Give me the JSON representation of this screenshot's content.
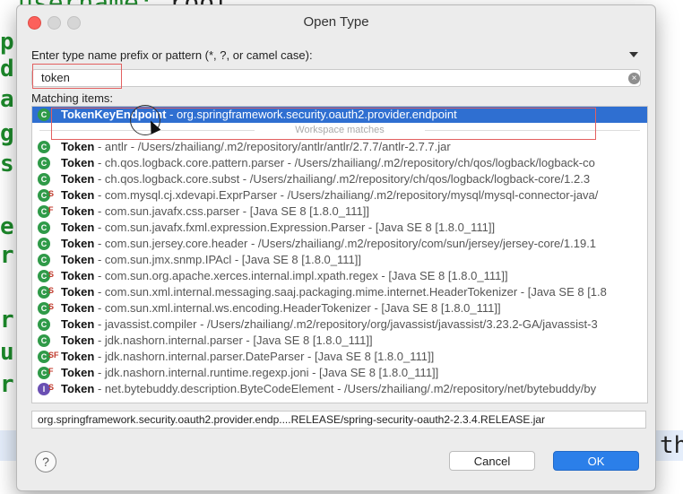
{
  "background_editor": {
    "top_line_key": "username:",
    "top_line_value": " root",
    "gutter_letters": [
      "p",
      "d",
      "a",
      "g",
      "s",
      "e",
      "r",
      "r",
      "u",
      "r"
    ],
    "right_text": "th"
  },
  "dialog": {
    "title": "Open Type",
    "prompt": "Enter type name prefix or pattern (*, ?, or camel case):",
    "search_value": "token",
    "matching_label": "Matching items:",
    "separator_label": "Workspace matches",
    "selected_row": {
      "name": "TokenKeyEndpoint",
      "detail": " - org.springframework.security.oauth2.provider.endpoint",
      "icon": "class-icon"
    },
    "rows": [
      {
        "name": "Token",
        "detail": " - antlr - /Users/zhailiang/.m2/repository/antlr/antlr/2.7.7/antlr-2.7.7.jar",
        "icon": "class-icon",
        "mod": ""
      },
      {
        "name": "Token",
        "detail": " - ch.qos.logback.core.pattern.parser - /Users/zhailiang/.m2/repository/ch/qos/logback/logback-co",
        "icon": "class-icon",
        "mod": ""
      },
      {
        "name": "Token",
        "detail": " - ch.qos.logback.core.subst - /Users/zhailiang/.m2/repository/ch/qos/logback/logback-core/1.2.3",
        "icon": "class-icon",
        "mod": ""
      },
      {
        "name": "Token",
        "detail": " - com.mysql.cj.xdevapi.ExprParser - /Users/zhailiang/.m2/repository/mysql/mysql-connector-java/",
        "icon": "class-icon",
        "mod": "S"
      },
      {
        "name": "Token",
        "detail": " - com.sun.javafx.css.parser - [Java SE 8 [1.8.0_111]]",
        "icon": "class-icon",
        "mod": "F"
      },
      {
        "name": "Token",
        "detail": " - com.sun.javafx.fxml.expression.Expression.Parser - [Java SE 8 [1.8.0_111]]",
        "icon": "class-icon",
        "mod": ""
      },
      {
        "name": "Token",
        "detail": " - com.sun.jersey.core.header - /Users/zhailiang/.m2/repository/com/sun/jersey/jersey-core/1.19.1",
        "icon": "class-icon",
        "mod": ""
      },
      {
        "name": "Token",
        "detail": " - com.sun.jmx.snmp.IPAcl - [Java SE 8 [1.8.0_111]]",
        "icon": "class-icon",
        "mod": ""
      },
      {
        "name": "Token",
        "detail": " - com.sun.org.apache.xerces.internal.impl.xpath.regex - [Java SE 8 [1.8.0_111]]",
        "icon": "class-icon",
        "mod": "S"
      },
      {
        "name": "Token",
        "detail": " - com.sun.xml.internal.messaging.saaj.packaging.mime.internet.HeaderTokenizer - [Java SE 8 [1.8",
        "icon": "class-icon",
        "mod": "S"
      },
      {
        "name": "Token",
        "detail": " - com.sun.xml.internal.ws.encoding.HeaderTokenizer - [Java SE 8 [1.8.0_111]]",
        "icon": "class-icon",
        "mod": "S"
      },
      {
        "name": "Token",
        "detail": " - javassist.compiler - /Users/zhailiang/.m2/repository/org/javassist/javassist/3.23.2-GA/javassist-3",
        "icon": "class-icon",
        "mod": ""
      },
      {
        "name": "Token",
        "detail": " - jdk.nashorn.internal.parser - [Java SE 8 [1.8.0_111]]",
        "icon": "class-icon",
        "mod": ""
      },
      {
        "name": "Token",
        "detail": " - jdk.nashorn.internal.parser.DateParser - [Java SE 8 [1.8.0_111]]",
        "icon": "class-icon",
        "mod": "SF"
      },
      {
        "name": "Token",
        "detail": " - jdk.nashorn.internal.runtime.regexp.joni - [Java SE 8 [1.8.0_111]]",
        "icon": "class-icon",
        "mod": "F"
      },
      {
        "name": "Token",
        "detail": " - net.bytebuddy.description.ByteCodeElement - /Users/zhailiang/.m2/repository/net/bytebuddy/by",
        "icon": "interface-icon",
        "mod": "S"
      }
    ],
    "status_path": "org.springframework.security.oauth2.provider.endp....RELEASE/spring-security-oauth2-2.3.4.RELEASE.jar",
    "help_label": "?",
    "cancel_label": "Cancel",
    "ok_label": "OK",
    "clear_glyph": "×",
    "accent_color": "#2f6fd1"
  }
}
